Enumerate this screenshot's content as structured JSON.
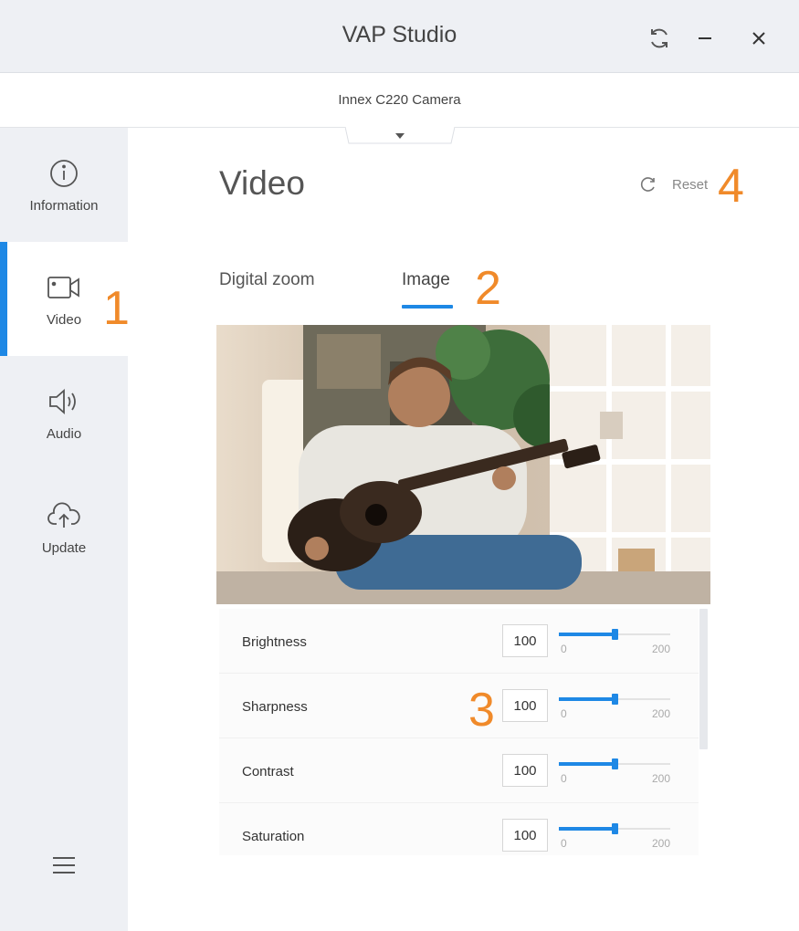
{
  "app": {
    "title": "VAP Studio"
  },
  "device": {
    "name": "Innex C220 Camera"
  },
  "sidebar": {
    "items": [
      {
        "label": "Information",
        "icon": "info-icon",
        "active": false
      },
      {
        "label": "Video",
        "icon": "video-camera-icon",
        "active": true
      },
      {
        "label": "Audio",
        "icon": "speaker-icon",
        "active": false
      },
      {
        "label": "Update",
        "icon": "cloud-upload-icon",
        "active": false
      }
    ],
    "menu_icon": "hamburger-menu-icon"
  },
  "main": {
    "title": "Video",
    "reset_label": "Reset",
    "tabs": [
      {
        "label": "Digital zoom",
        "active": false
      },
      {
        "label": "Image",
        "active": true
      }
    ],
    "annotations": [
      "1",
      "2",
      "3",
      "4"
    ]
  },
  "controls": [
    {
      "label": "Brightness",
      "value": "100",
      "min": "0",
      "max": "200",
      "level": 0.5
    },
    {
      "label": "Sharpness",
      "value": "100",
      "min": "0",
      "max": "200",
      "level": 0.5
    },
    {
      "label": "Contrast",
      "value": "100",
      "min": "0",
      "max": "200",
      "level": 0.5
    },
    {
      "label": "Saturation",
      "value": "100",
      "min": "0",
      "max": "200",
      "level": 0.5
    }
  ],
  "colors": {
    "accent": "#1e88e5",
    "annotation": "#f08a2a",
    "sidebar_bg": "#eef0f4"
  }
}
